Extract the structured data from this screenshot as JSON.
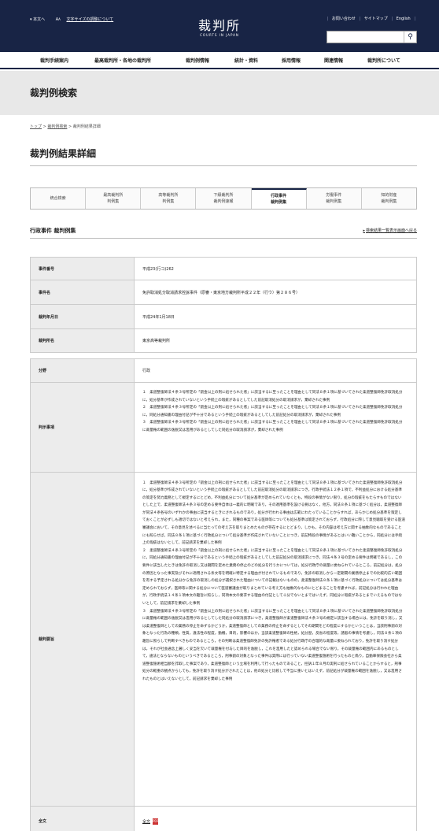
{
  "header": {
    "util_links": [
      "本文へ",
      "文字サイズの調整について"
    ],
    "logo_text": "裁判所",
    "logo_sub": "COURTS IN JAPAN",
    "top_links": [
      "お問い合わせ",
      "サイトマップ",
      "English"
    ],
    "search_placeholder": "",
    "search_icon": "magnifier-icon"
  },
  "gnav": [
    "裁判手続案内",
    "最高裁判所・各地の裁判所",
    "裁判例情報",
    "統計・資料",
    "採用情報",
    "関連情報",
    "裁判所について"
  ],
  "band_title": "裁判例検索",
  "breadcrumb": [
    "トップ",
    "裁判例検索",
    "裁判例結果詳細"
  ],
  "page_title": "裁判例結果詳細",
  "tabs": [
    [
      "統合検索",
      ""
    ],
    [
      "最高裁判所",
      "判例集"
    ],
    [
      "高等裁判所",
      "判例集"
    ],
    [
      "下級裁判所",
      "裁判例速報"
    ],
    [
      "行政事件",
      "裁判例集"
    ],
    [
      "労働事件",
      "裁判例集"
    ],
    [
      "知的財産",
      "裁判例集"
    ]
  ],
  "active_tab": 4,
  "section_title": "行政事件 裁判例集",
  "back_link": "検索結果一覧表示画面へ戻る",
  "table1": [
    {
      "label": "事件番号",
      "value": "平成23(行コ)262"
    },
    {
      "label": "事件名",
      "value": "免許取消処分取消請求控訴事件（原審・東京地方裁判所平成２２年（行ウ）第２８６号）"
    },
    {
      "label": "裁判年月日",
      "value": "平成24年1月18日"
    },
    {
      "label": "裁判所名",
      "value": "東京高等裁判所"
    }
  ],
  "table2": [
    {
      "label": "分野",
      "value": "行政"
    },
    {
      "label": "判示事項",
      "value": "１　柔道整復師法４条３号所定の「罰金以上の刑に処せられた者」に該当するに至ったことを理由として同法８条１項に基づいてされた柔道整復師免許取消処分に，処分基準が作成されていないという手続上の瑕疵があるとしてした前記取消処分の取消請求が，棄却された事例\n２　柔道整復師法４条３号所定の「罰金以上の刑に処せられた者」に該当するに至ったことを理由として同法８条１項に基づいてされた柔道整復師免許取消処分に，同処分通知書の理由付記が不十分であるという手続上の瑕疵があるとしてした前記処分の取消請求が，棄却された事例\n３　柔道整復師法４条３号所定の「罰金以上の刑に処せられた者」に該当するに至ったことを理由として同法８条１項に基づいてされた柔道整復師免許取消処分に裁量権の範囲の逸脱又は濫用があるとしてした同処分の取消請求が，棄却された事例"
    },
    {
      "label": "裁判要旨",
      "value": "１　柔道整復師法４条３号所定の「罰金以上の刑に処せられた者」に該当するに至ったことを理由として同法８条１項に基づいてされた柔道整復師免許取消処分に，処分基準が作成されていないという手続上の瑕疵があるとしてした前記取消処分の取消請求につき，行政手続法１２条１項で，不利益処分における処分基準の策定を努力義務として規定するにとどめ，不利益処分について処分基準が定められていなくとも，特段の事情がない限り，処分の瑕疵をもたらすものではないとした上で，柔道整復師法４条３号の定める要件自体は一義的に明確であり，その適用基準を設ける要はなく，他方，同法８条１項に基づく処分は，柔道整復師が同法４条各号のいずれかの事由に該当するときにされるものであり，処分が行われる事由は広範にわたっていることからすれば，あらかじめ処分基準を策定しておくことが必ずしも適切ではないと考えられ，また，同種の事案である医師等についても処分基準は策定されておらず，行政処分に際して意見聴取を受ける医道審議会において，その意見を述べるに当たっての考え方を取りまとめたものが存在するにとどまり，しかも，その内容は考え方に関する抽象的なものであることにも照らせば，同法８条１項に基づく行政処分について処分基準が作成されていないことにつき，前記特段の事情があるとはいい難いことから，同処分には手続上の瑕疵はないとして，前記請求を棄却した事例\n２　柔道整復師法４条３号所定の「罰金以上の刑に処せられた者」に該当するに至ったことを理由として同法８条１項に基づいてされた柔道整復師免許取消処分に，同処分通知書の理由付記が不十分であるという手続上の瑕疵があるとしてした前記処分の取消請求につき，同法４条３号の定める要件は明確であるし，この要件に該当したときは免許の取消し又は期間を定めた業務の停止のどの処分を行うかについては，処分行政庁の裁量に委ねられているところ，前記処分は，処分の原因となった事実及びそれに適用される条文等を明確に特定する理由が付されているものであり，免許の取消しから一定期間の業務停止までの比較的広い範囲を有する予定される処分から免許の取消しの処分が選択された理由についての記載はないものの，柔道整復師法８条１項に基づく行政処分については処分基準は定められておらず，医師等に関する処分について医道審議会が取りまとめている考え方も抽象的なものにとどまることを考慮すれば，前記処分は行われた理由が，行政手続法１４条１項本文の趣旨に照らし，同項本文の要求する理由の付記として十分でないとまではいえず，同処分に瑕疵があるとまでいえるものではないとして，前記請求を棄却した事例\n３　柔道整復師法４条３号所定の「罰金以上の刑に処せられた者」に該当するに至ったことを理由として同法８条１項に基づいてされた柔道整復師免許取消処分に裁量権の範囲の逸脱又は濫用があるとしてした同処分の取消請求につき，柔道整復師が柔道整復師法４条３号の規定に該当する場合には，免許を取り消し，又は柔道整復師としての業務の停止を命ずるかどうか，柔道整復師としての業務の停止を命ずるとしてその期間をどの程度にするかということは，当該刑事罰の対象となった行為の種類，性質，違法性の程度，動機，目的，影響のほか，当該柔道整復師の性格，処分歴，反省の程度等，諸般の事情を考慮し，同法８条１項の趣旨に照らして判断すべきものであるところ，その判断は柔道整復師免許の免許権者である処分行政庁の合理的な裁量に委ねられており，免許を取り消す処分は，それが社会通念上著しく妥当を欠いて裁量権を付与した目的を逸脱し，これを濫用したと認められる場合でない限り，その裁量権の範囲内にあるものとして，違法とならないものというべきであるところ，刑事罰の対象となった事件は実際には行っていない柔道整復施術を行ったものと偽り，自動車保険会社から柔道整復施術相当額を詐取した事案であり，柔道整復師という立場を利用して行ったものであること，控訴１年８月の実刑に処せられていることからすると，刑事処分の軽重の観点からしても，免許を取り消す処分がされたことは，他の処分と比較して不当に重いとはいえず，前記処分が裁量権の範囲を逸脱し，又は濫用されたものとはいえないとして，前記請求を棄却した事例"
    },
    {
      "label": "全文",
      "value": "全文"
    }
  ],
  "pdf_icon": "pdf-icon"
}
